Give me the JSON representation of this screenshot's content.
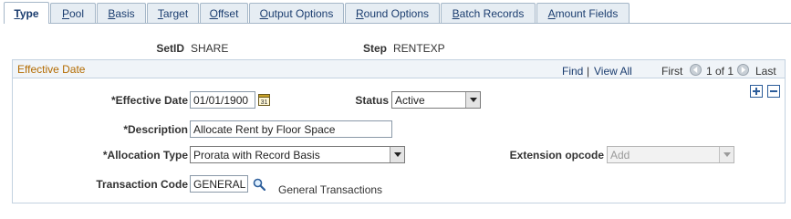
{
  "tabs": [
    {
      "label": "Type",
      "ul": "T",
      "rest": "ype",
      "active": true
    },
    {
      "label": "Pool",
      "ul": "P",
      "rest": "ool",
      "active": false
    },
    {
      "label": "Basis",
      "ul": "B",
      "rest": "asis",
      "active": false
    },
    {
      "label": "Target",
      "ul": "T",
      "rest": "arget",
      "active": false
    },
    {
      "label": "Offset",
      "ul": "O",
      "rest": "ffset",
      "active": false
    },
    {
      "label": "Output Options",
      "ul": "O",
      "rest": "utput Options",
      "active": false
    },
    {
      "label": "Round Options",
      "ul": "R",
      "rest": "ound Options",
      "active": false
    },
    {
      "label": "Batch Records",
      "ul": "B",
      "rest": "atch Records",
      "active": false
    },
    {
      "label": "Amount Fields",
      "ul": "A",
      "rest": "mount Fields",
      "active": false
    }
  ],
  "header": {
    "setid_label": "SetID",
    "setid_value": "SHARE",
    "step_label": "Step",
    "step_value": "RENTEXP"
  },
  "group": {
    "title": "Effective Date",
    "find": "Find",
    "separator": "|",
    "view_all": "View All",
    "first": "First",
    "range": "1 of 1",
    "last": "Last"
  },
  "form": {
    "effective_date_label": "*Effective Date",
    "effective_date_value": "01/01/1900",
    "status_label": "Status",
    "status_value": "Active",
    "description_label": "*Description",
    "description_value": "Allocate Rent by Floor Space",
    "allocation_type_label": "*Allocation Type",
    "allocation_type_value": "Prorata with Record Basis",
    "extension_opcode_label": "Extension opcode",
    "extension_opcode_value": "Add",
    "transaction_code_label": "Transaction Code",
    "transaction_code_value": "GENERAL",
    "transaction_code_desc": "General Transactions"
  },
  "colors": {
    "accent": "#1b3d6f",
    "group_title": "#b36b00"
  }
}
